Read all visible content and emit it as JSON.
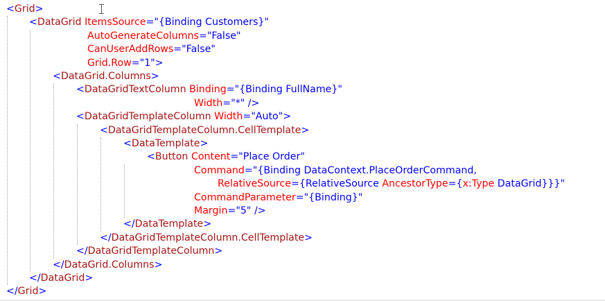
{
  "editor": {
    "language": "XAML",
    "lines": [
      [
        {
          "t": "<",
          "c": "br"
        },
        {
          "t": "Grid",
          "c": "tag"
        },
        {
          "t": ">",
          "c": "br"
        }
      ],
      [
        {
          "t": "<",
          "c": "br"
        },
        {
          "t": "DataGrid",
          "c": "tag"
        },
        {
          "t": " ",
          "c": "br"
        },
        {
          "t": "ItemsSource",
          "c": "attr"
        },
        {
          "t": "=\"{Binding Customers}\"",
          "c": "val"
        }
      ],
      [
        {
          "t": "AutoGenerateColumns",
          "c": "attr"
        },
        {
          "t": "=\"False\"",
          "c": "val"
        }
      ],
      [
        {
          "t": "CanUserAddRows",
          "c": "attr"
        },
        {
          "t": "=\"False\"",
          "c": "val"
        }
      ],
      [
        {
          "t": "Grid.Row",
          "c": "attr"
        },
        {
          "t": "=\"1\">",
          "c": "val"
        }
      ],
      [
        {
          "t": "<",
          "c": "br"
        },
        {
          "t": "DataGrid.Columns",
          "c": "tag"
        },
        {
          "t": ">",
          "c": "br"
        }
      ],
      [
        {
          "t": "<",
          "c": "br"
        },
        {
          "t": "DataGridTextColumn",
          "c": "tag"
        },
        {
          "t": " ",
          "c": "br"
        },
        {
          "t": "Binding",
          "c": "attr"
        },
        {
          "t": "=\"{Binding FullName}\"",
          "c": "val"
        }
      ],
      [
        {
          "t": "Width",
          "c": "attr"
        },
        {
          "t": "=\"*\" />",
          "c": "val"
        }
      ],
      [
        {
          "t": "<",
          "c": "br"
        },
        {
          "t": "DataGridTemplateColumn",
          "c": "tag"
        },
        {
          "t": " ",
          "c": "br"
        },
        {
          "t": "Width",
          "c": "attr"
        },
        {
          "t": "=\"Auto\">",
          "c": "val"
        }
      ],
      [
        {
          "t": "<",
          "c": "br"
        },
        {
          "t": "DataGridTemplateColumn.CellTemplate",
          "c": "tag"
        },
        {
          "t": ">",
          "c": "br"
        }
      ],
      [
        {
          "t": "<",
          "c": "br"
        },
        {
          "t": "DataTemplate",
          "c": "tag"
        },
        {
          "t": ">",
          "c": "br"
        }
      ],
      [
        {
          "t": "<",
          "c": "br"
        },
        {
          "t": "Button",
          "c": "tag"
        },
        {
          "t": " ",
          "c": "br"
        },
        {
          "t": "Content",
          "c": "attr"
        },
        {
          "t": "=\"Place Order\"",
          "c": "val"
        }
      ],
      [
        {
          "t": "Command",
          "c": "attr"
        },
        {
          "t": "=\"{Binding DataContext.PlaceOrderCommand,",
          "c": "val"
        }
      ],
      [
        {
          "t": "RelativeSource",
          "c": "attr"
        },
        {
          "t": "={RelativeSource ",
          "c": "val"
        },
        {
          "t": "AncestorType",
          "c": "attr"
        },
        {
          "t": "={",
          "c": "val"
        },
        {
          "t": "x:Type",
          "c": "attr"
        },
        {
          "t": " DataGrid}}}\"",
          "c": "val"
        }
      ],
      [
        {
          "t": "CommandParameter",
          "c": "attr"
        },
        {
          "t": "=\"{Binding}\"",
          "c": "val"
        }
      ],
      [
        {
          "t": "Margin",
          "c": "attr"
        },
        {
          "t": "=\"5\" />",
          "c": "val"
        }
      ],
      [
        {
          "t": "</",
          "c": "br"
        },
        {
          "t": "DataTemplate",
          "c": "tag"
        },
        {
          "t": ">",
          "c": "br"
        }
      ],
      [
        {
          "t": "</",
          "c": "br"
        },
        {
          "t": "DataGridTemplateColumn.CellTemplate",
          "c": "tag"
        },
        {
          "t": ">",
          "c": "br"
        }
      ],
      [
        {
          "t": "</",
          "c": "br"
        },
        {
          "t": "DataGridTemplateColumn",
          "c": "tag"
        },
        {
          "t": ">",
          "c": "br"
        }
      ],
      [
        {
          "t": "</",
          "c": "br"
        },
        {
          "t": "DataGrid.Columns",
          "c": "tag"
        },
        {
          "t": ">",
          "c": "br"
        }
      ],
      [
        {
          "t": "</",
          "c": "br"
        },
        {
          "t": "DataGrid",
          "c": "tag"
        },
        {
          "t": ">",
          "c": "br"
        }
      ],
      [
        {
          "t": "</",
          "c": "br"
        },
        {
          "t": "Grid",
          "c": "tag"
        },
        {
          "t": ">",
          "c": "br"
        }
      ]
    ]
  },
  "colors": {
    "tag": "#a31515",
    "bracket": "#0000ff",
    "attribute": "#ff0000",
    "value": "#0000ff",
    "background": "#ffffff"
  }
}
